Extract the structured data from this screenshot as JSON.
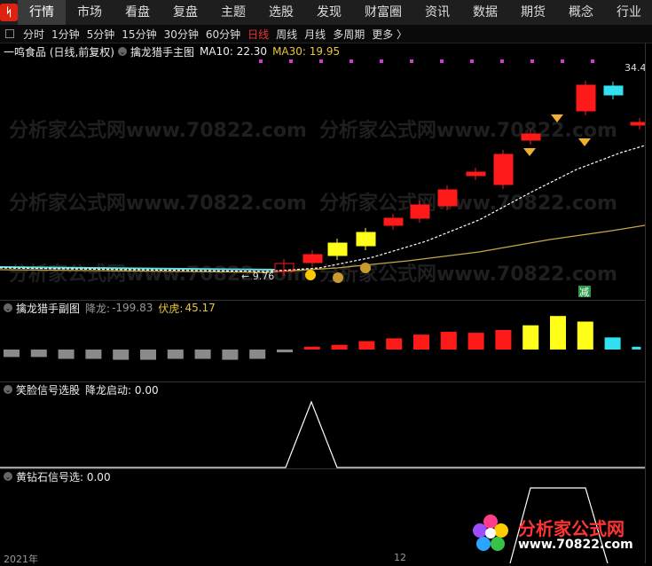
{
  "nav": {
    "tabs": [
      "行情",
      "市场",
      "看盘",
      "复盘",
      "主题",
      "选股",
      "发现",
      "财富圈",
      "资讯",
      "数据",
      "期货",
      "概念",
      "行业"
    ],
    "active": 0
  },
  "periods": [
    "分时",
    "1分钟",
    "5分钟",
    "15分钟",
    "30分钟",
    "60分钟",
    "日线",
    "周线",
    "月线",
    "多周期",
    "更多 〉"
  ],
  "active_period": 6,
  "main_panel": {
    "stock": "一鸣食品 (日线,前复权)",
    "indicator": "擒龙猎手主图",
    "ma10_label": "MA10: 22.30",
    "ma30_label": "MA30: 19.95",
    "high_label": "34.4",
    "low_label": "9.76",
    "sell_mark": "减"
  },
  "sub1": {
    "title": "擒龙猎手副图",
    "jianglong_label": "降龙:",
    "jianglong_value": "-199.83",
    "fuhu_label": "伏虎:",
    "fuhu_value": "45.17"
  },
  "sub2": {
    "title": "笑脸信号选股",
    "signal": "降龙启动: 0.00"
  },
  "sub3": {
    "title": "黄钻石信号选: 0.00"
  },
  "bottom_axis": {
    "left": "2021年",
    "mid": "12"
  },
  "watermark": {
    "text": "分析家公式网www.70822.com",
    "brand_title": "分析家公式网",
    "brand_url": "www.70822.com"
  },
  "colors": {
    "up": "#ff1a1a",
    "yellow": "#ffff1a",
    "cyan": "#33e0f0",
    "gray": "#888888",
    "ma30": "#c9a845"
  },
  "chart_data": {
    "type": "bar",
    "title": "擒龙猎手副图",
    "series": [
      {
        "name": "降龙/伏虎",
        "values": [
          -8,
          -8,
          -10,
          -10,
          -11,
          -11,
          -10,
          -10,
          -11,
          -10,
          -3,
          3,
          5,
          9,
          12,
          16,
          19,
          18,
          21,
          26,
          36,
          30,
          13,
          3
        ]
      }
    ],
    "colors_by_bar": [
      "gray",
      "gray",
      "gray",
      "gray",
      "gray",
      "gray",
      "gray",
      "gray",
      "gray",
      "gray",
      "gray",
      "red",
      "red",
      "red",
      "red",
      "red",
      "red",
      "red",
      "red",
      "yellow",
      "yellow",
      "yellow",
      "cyan",
      "cyan"
    ]
  }
}
